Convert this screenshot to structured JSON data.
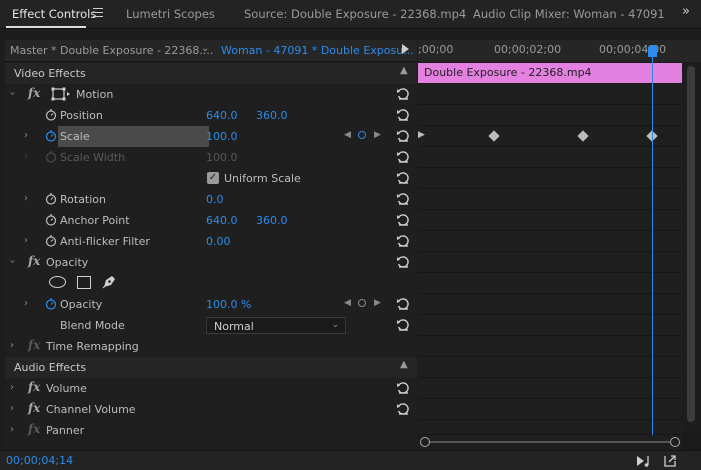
{
  "tabs": [
    {
      "label": "Effect Controls",
      "active": true
    },
    {
      "label": "Lumetri Scopes",
      "active": false
    },
    {
      "label": "Source: Double Exposure - 22368.mp4",
      "active": false
    },
    {
      "label": "Audio Clip Mixer: Woman - 47091",
      "active": false
    }
  ],
  "more_tabs": "»",
  "clipbar": {
    "master": "Master * Double Exposure - 22368....",
    "clip": "Woman - 47091 * Double Exposu..."
  },
  "sections": {
    "video_effects": "Video Effects",
    "audio_effects": "Audio Effects"
  },
  "motion": {
    "label": "Motion",
    "position": {
      "label": "Position",
      "x": "640.0",
      "y": "360.0"
    },
    "scale": {
      "label": "Scale",
      "value": "100.0"
    },
    "scale_width": {
      "label": "Scale Width",
      "value": "100.0"
    },
    "uniform_scale": {
      "label": "Uniform Scale",
      "checked": true
    },
    "rotation": {
      "label": "Rotation",
      "value": "0.0"
    },
    "anchor_point": {
      "label": "Anchor Point",
      "x": "640.0",
      "y": "360.0"
    },
    "anti_flicker": {
      "label": "Anti-flicker Filter",
      "value": "0.00"
    }
  },
  "opacity": {
    "label": "Opacity",
    "value_label": "Opacity",
    "value": "100.0 %",
    "blend_label": "Blend Mode",
    "blend_value": "Normal"
  },
  "time_remapping": "Time Remapping",
  "audio": {
    "volume": "Volume",
    "channel_volume": "Channel Volume",
    "panner": "Panner"
  },
  "timeline": {
    "ruler": [
      ";00;00",
      "00;00;02;00",
      "00;00;04;00"
    ],
    "clip_name": "Double Exposure - 22368.mp4",
    "scale_keyframes": 3
  },
  "timecode": "00;00;04;14",
  "colors": {
    "accent": "#2d8ceb",
    "clip": "#e481e0",
    "background": "#1d1d1d"
  }
}
